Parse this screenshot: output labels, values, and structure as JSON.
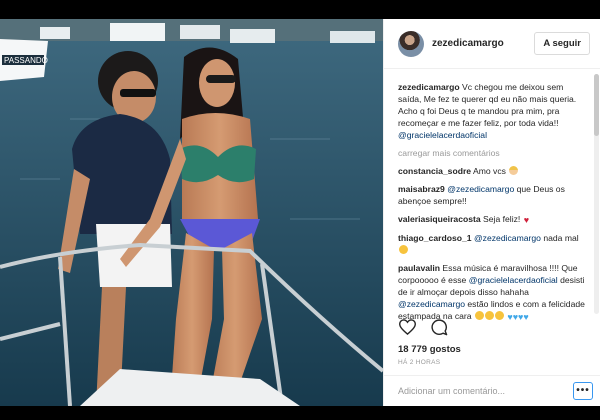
{
  "post": {
    "username": "zezedicamargo",
    "follow_label": "A seguir",
    "boat_text": "PASSANDO",
    "caption": {
      "username": "zezedicamargo",
      "text": "Vc chegou me deixou sem saída, Me fez te querer qd eu não mais queria. Acho q foi Deus q te mandou pra mim, pra recomeçar e me fazer feliz, por toda vida!!",
      "mention": "@gracielelacerdaoficial"
    },
    "load_more": "carregar mais comentários",
    "comments": [
      {
        "username": "constancia_sodre",
        "text": "Amo vcs",
        "mention": "",
        "after": "",
        "emoji": "blonde-woman-emoji"
      },
      {
        "username": "maisabraz9",
        "text": "",
        "mention": "@zezedicamargo",
        "after": "que Deus os abençoe sempre!!",
        "emoji": ""
      },
      {
        "username": "valeriasiqueiracosta",
        "text": "Seja feliz!",
        "mention": "",
        "after": "",
        "emoji": "red-heart-emoji"
      },
      {
        "username": "thiago_cardoso_1",
        "text": "",
        "mention": "@zezedicamargo",
        "after": "nada mal",
        "emoji": "smile-emoji"
      },
      {
        "username": "paulavalin",
        "text": "Essa música é maravilhosa !!!! Que corpooooo é esse",
        "mention": "@gracielelacerdaoficial",
        "after": "desisti de ir almoçar depois disso hahaha",
        "mention2": "@zezedicamargo",
        "after2": "estão lindos e com a felicidade estampada na cara",
        "emoji": "heart-eyes-and-blue-hearts-emoji"
      }
    ],
    "likes": "18 779 gostos",
    "time": "HÁ 2 HORAS",
    "add_comment_placeholder": "Adicionar um comentário...",
    "more_label": "•••",
    "colors": {
      "mention": "#003569",
      "follow_border": "#dbdbdb",
      "more_border": "#3897f0",
      "muted": "#999999"
    },
    "icons": [
      "avatar",
      "heart-icon",
      "comment-icon",
      "more-options-icon"
    ]
  }
}
